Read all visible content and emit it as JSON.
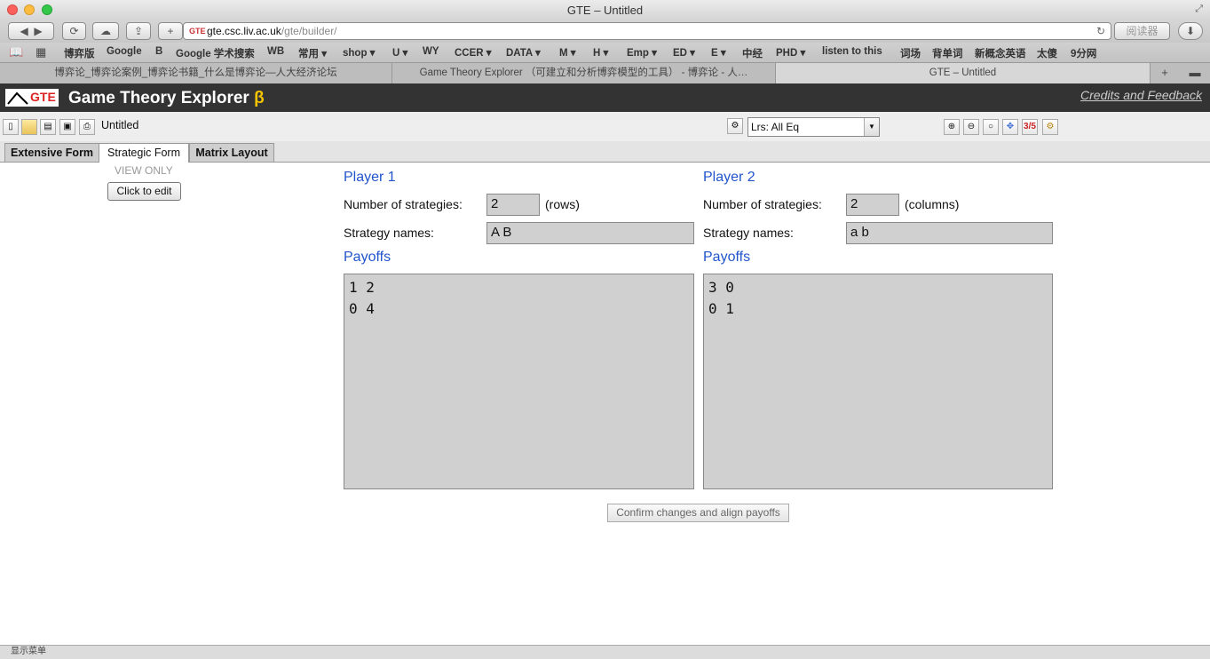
{
  "window": {
    "title": "GTE – Untitled"
  },
  "browser": {
    "url_host": "gte.csc.liv.ac.uk",
    "url_path": "/gte/builder/",
    "reader_label": "阅读器",
    "bookmarks": [
      "博弈版",
      "Google",
      "B",
      "Google 学术搜索",
      "WB",
      "常用 ▾",
      "shop ▾",
      "U ▾",
      "WY",
      "CCER ▾",
      "DATA ▾",
      "M ▾",
      "H ▾",
      "Emp ▾",
      "ED ▾",
      "E ▾",
      "中经",
      "PHD ▾",
      "listen to this",
      "词场",
      "背单词",
      "新概念英语",
      "太傻",
      "9分网"
    ],
    "tabs": [
      "博弈论_博弈论案例_博弈论书籍_什么是博弈论—人大经济论坛",
      "Game Theory Explorer （可建立和分析博弈模型的工具） - 博弈论 - 人…",
      "GTE – Untitled"
    ]
  },
  "app": {
    "logo_text": "GTE",
    "title": "Game Theory Explorer",
    "beta": "β",
    "credits": "Credits and Feedback",
    "doc_name": "Untitled",
    "solver": "Lrs: All Eq",
    "fraction_icon": "3/5",
    "mode_tabs": [
      "Extensive Form",
      "Strategic Form",
      "Matrix Layout"
    ],
    "view_only": "VIEW ONLY",
    "edit_button": "Click to edit",
    "confirm_button": "Confirm changes and align payoffs"
  },
  "player1": {
    "heading": "Player 1",
    "num_label": "Number of strategies:",
    "num_value": "2",
    "num_suffix": "(rows)",
    "names_label": "Strategy names:",
    "names_value": "A B",
    "payoffs_heading": "Payoffs",
    "payoffs": "1 2\n0 4"
  },
  "player2": {
    "heading": "Player 2",
    "num_label": "Number of strategies:",
    "num_value": "2",
    "num_suffix": "(columns)",
    "names_label": "Strategy names:",
    "names_value": "a b",
    "payoffs_heading": "Payoffs",
    "payoffs": "3 0\n0 1"
  },
  "status": {
    "text": "显示菜单"
  },
  "colors": {
    "heading_blue": "#2255cc",
    "header_bg": "#333333",
    "beta_yellow": "#f5c400"
  }
}
